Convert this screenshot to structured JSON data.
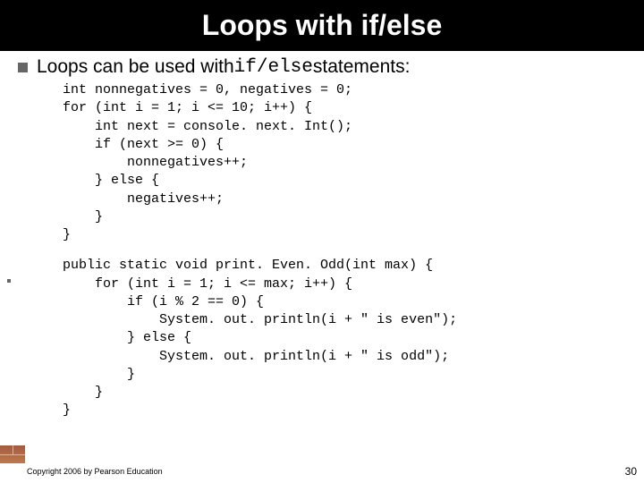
{
  "title": "Loops with if/else",
  "bullet": {
    "pre": "Loops can be used with ",
    "code": "if/else",
    "post": " statements:"
  },
  "code1": "int nonnegatives = 0, negatives = 0;\nfor (int i = 1; i <= 10; i++) {\n    int next = console. next. Int();\n    if (next >= 0) {\n        nonnegatives++;\n    } else {\n        negatives++;\n    }\n}",
  "code2": "public static void print. Even. Odd(int max) {\n    for (int i = 1; i <= max; i++) {\n        if (i % 2 == 0) {\n            System. out. println(i + \" is even\");\n        } else {\n            System. out. println(i + \" is odd\");\n        }\n    }\n}",
  "footer": "Copyright 2006 by Pearson Education",
  "page": "30"
}
